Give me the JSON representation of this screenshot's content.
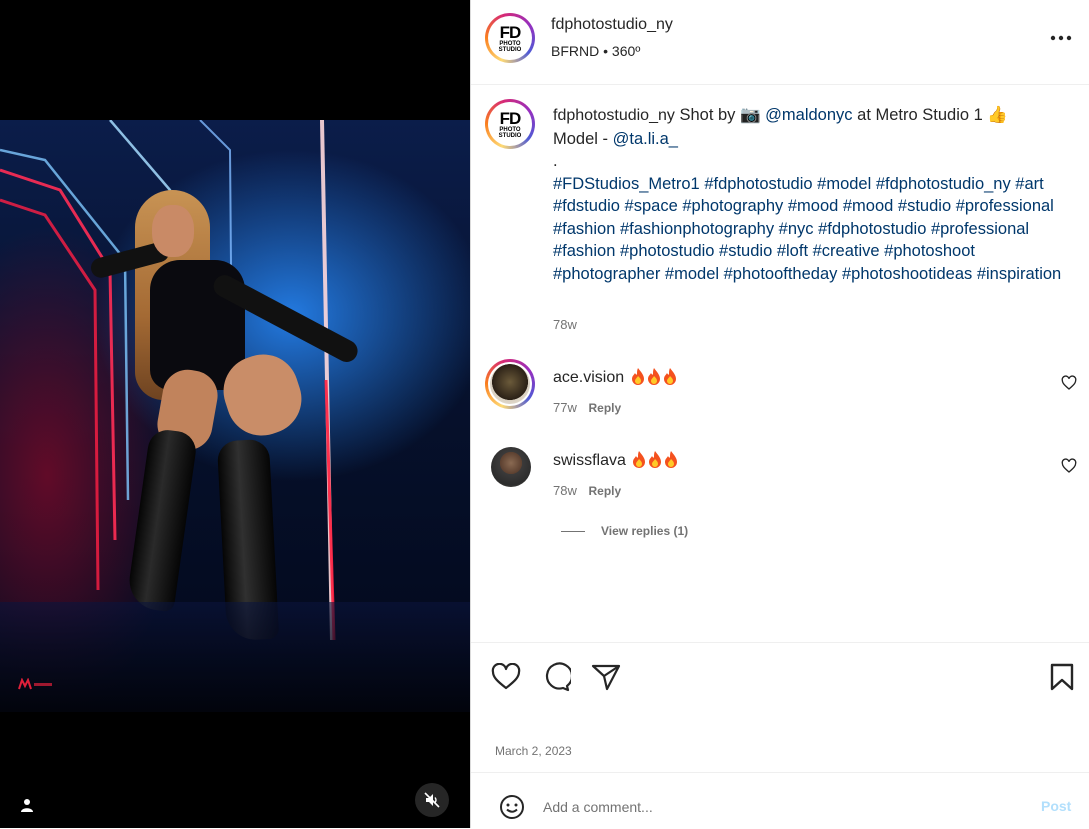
{
  "header": {
    "username": "fdphotostudio_ny",
    "subtitle": "BFRND • 360º",
    "logo_top": "FD",
    "logo_bottom": "PHOTO STUDIO"
  },
  "caption": {
    "username": "fdphotostudio_ny",
    "text_before_camera": "Shot by",
    "camera_emoji": "📷",
    "photographer": "@maldonyc",
    "text_after_photographer": "at Metro Studio 1",
    "thumbs_emoji": "👍",
    "model_label": "Model -",
    "model_handle": "@ta.li.a_",
    "dot": ".",
    "hashtags": "#FDStudios_Metro1 #fdphotostudio #model #fdphotostudio_ny #art #fdstudio #space #photography #mood #mood #studio #professional #fashion #fashionphotography #nyc #fdphotostudio #professional #fashion #photostudio #studio #loft #creative #photoshoot #photographer #model #photooftheday #photoshootideas  #inspiration",
    "time": "78w"
  },
  "comments": [
    {
      "username": "ace.vision",
      "time": "77w",
      "reply_label": "Reply"
    },
    {
      "username": "swissflava",
      "time": "78w",
      "reply_label": "Reply"
    }
  ],
  "view_replies": "View replies (1)",
  "date": "March 2, 2023",
  "comment_box": {
    "placeholder": "Add a comment...",
    "post_label": "Post"
  },
  "colors": {
    "link": "#00376b",
    "muted": "#737373",
    "post_disabled": "#b2dffc"
  }
}
